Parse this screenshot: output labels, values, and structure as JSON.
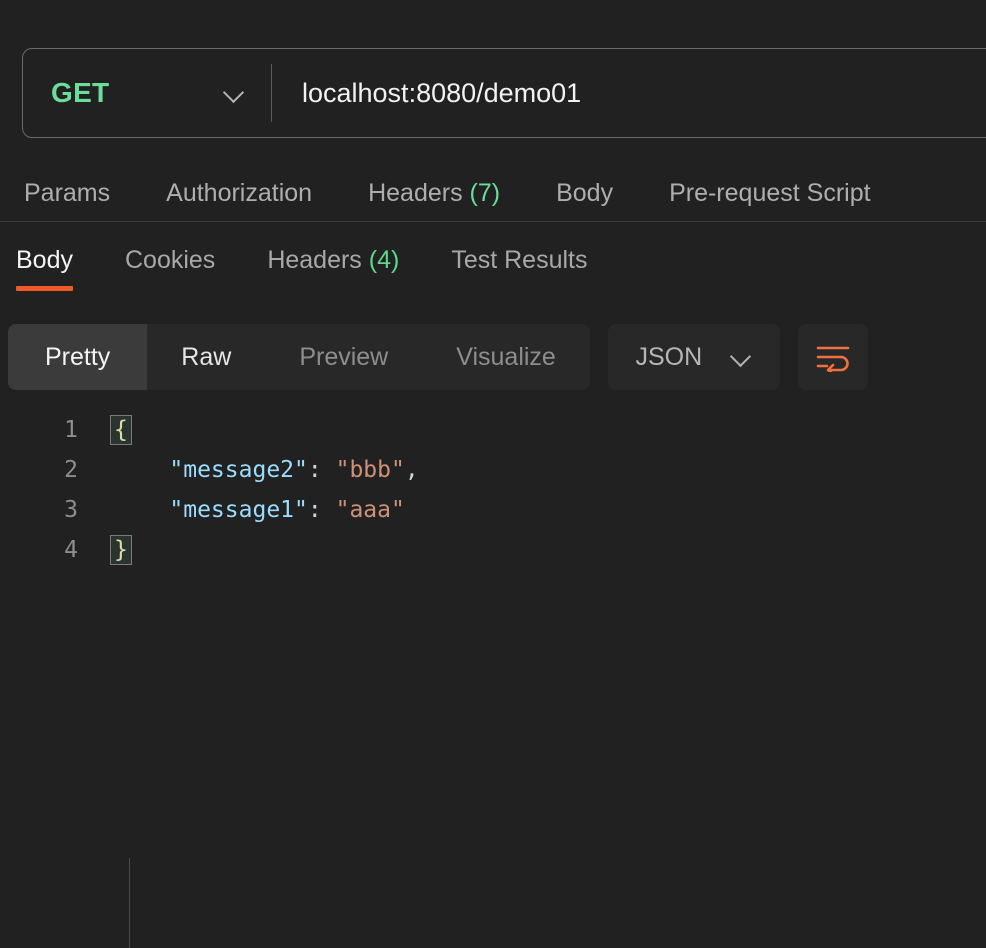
{
  "request_bar": {
    "method": "GET",
    "method_dropdown_icon": "chevron-down-icon",
    "url": "localhost:8080/demo01"
  },
  "request_tabs": [
    {
      "label": "Params",
      "count": "",
      "active": false
    },
    {
      "label": "Authorization",
      "count": "",
      "active": false
    },
    {
      "label": "Headers",
      "count": "(7)",
      "active": false
    },
    {
      "label": "Body",
      "count": "",
      "active": false
    },
    {
      "label": "Pre-request Script",
      "count": "",
      "active": false
    }
  ],
  "response_tabs": [
    {
      "label": "Body",
      "count": "",
      "active": true
    },
    {
      "label": "Cookies",
      "count": "",
      "active": false
    },
    {
      "label": "Headers",
      "count": "(4)",
      "active": false
    },
    {
      "label": "Test Results",
      "count": "",
      "active": false
    }
  ],
  "format_toolbar": {
    "segments": [
      {
        "label": "Pretty",
        "active": true
      },
      {
        "label": "Raw",
        "active": false
      },
      {
        "label": "Preview",
        "active": false
      },
      {
        "label": "Visualize",
        "active": false
      }
    ],
    "language_select": {
      "value": "JSON",
      "icon": "chevron-down-icon"
    },
    "wrap_button_icon": "word-wrap-icon"
  },
  "response_body": {
    "language": "JSON",
    "lines": [
      {
        "number": "1",
        "open_brace": "{",
        "key": "",
        "colon": "",
        "value": "",
        "comma": ""
      },
      {
        "number": "2",
        "open_brace": "",
        "key": "\"message2\"",
        "colon": ":",
        "value": "\"bbb\"",
        "comma": ","
      },
      {
        "number": "3",
        "open_brace": "",
        "key": "\"message1\"",
        "colon": ":",
        "value": "\"aaa\"",
        "comma": ""
      },
      {
        "number": "4",
        "open_brace": "}",
        "key": "",
        "colon": "",
        "value": "",
        "comma": ""
      }
    ],
    "raw_text": "{\n    \"message2\": \"bbb\",\n    \"message1\": \"aaa\"\n}"
  },
  "colors": {
    "background": "#212121",
    "accent_orange": "#f05a28",
    "method_green": "#6bdd9a",
    "count_green": "#5ed88a",
    "json_key": "#9cdcfe",
    "json_value": "#ce9178",
    "brace": "#dcdcaa"
  }
}
